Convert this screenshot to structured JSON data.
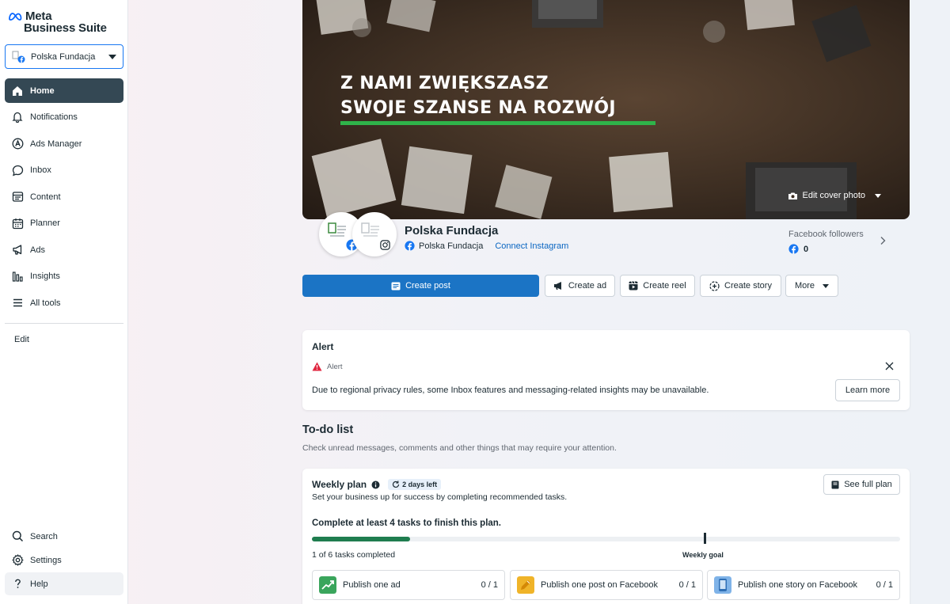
{
  "sidebar": {
    "logo_meta": "Meta",
    "logo_business_suite": "Business Suite",
    "account": "Polska Fundacja",
    "nav": [
      {
        "label": "Home",
        "icon": "home-icon",
        "active": true
      },
      {
        "label": "Notifications",
        "icon": "bell-icon"
      },
      {
        "label": "Ads Manager",
        "icon": "ads-manager-icon"
      },
      {
        "label": "Inbox",
        "icon": "inbox-icon"
      },
      {
        "label": "Content",
        "icon": "content-icon"
      },
      {
        "label": "Planner",
        "icon": "calendar-icon"
      },
      {
        "label": "Ads",
        "icon": "megaphone-icon"
      },
      {
        "label": "Insights",
        "icon": "bar-chart-icon"
      },
      {
        "label": "All tools",
        "icon": "menu-icon"
      }
    ],
    "edit": "Edit",
    "bottom": [
      {
        "label": "Search",
        "icon": "search-icon"
      },
      {
        "label": "Settings",
        "icon": "gear-icon"
      },
      {
        "label": "Help",
        "icon": "help-icon"
      }
    ]
  },
  "cover": {
    "headline_line1": "Z NAMI ZWIĘKSZASZ",
    "headline_line2": "SWOJE SZANSE NA ROZWÓJ",
    "edit_cover": "Edit cover photo"
  },
  "profile": {
    "name": "Polska Fundacja",
    "fb_page": "Polska Fundacja",
    "connect_instagram": "Connect Instagram",
    "followers_label": "Facebook followers",
    "followers_count": "0"
  },
  "actions": {
    "create_post": "Create post",
    "create_ad": "Create ad",
    "create_reel": "Create reel",
    "create_story": "Create story",
    "more": "More"
  },
  "alert": {
    "title": "Alert",
    "tag": "Alert",
    "message": "Due to regional privacy rules, some Inbox features and messaging-related insights may be unavailable.",
    "learn_more": "Learn more"
  },
  "todo": {
    "title": "To-do list",
    "subtitle": "Check unread messages, comments and other things that may require your attention."
  },
  "weekly_plan": {
    "title": "Weekly plan",
    "days_left": "2 days left",
    "description": "Set your business up for success by completing recommended tasks.",
    "see_full_plan": "See full plan",
    "goal_heading": "Complete at least 4 tasks to finish this plan.",
    "progress_fraction": 0.1667,
    "weekly_goal_fraction": 0.6667,
    "tasks_completed": "1 of 6 tasks completed",
    "weekly_goal_label": "Weekly goal",
    "tasks": [
      {
        "name": "Publish one ad",
        "count": "0 / 1",
        "color": "#3aa55c"
      },
      {
        "name": "Publish one post on Facebook",
        "count": "0 / 1",
        "color": "#f0b429"
      },
      {
        "name": "Publish one story on Facebook",
        "count": "0 / 1",
        "color": "#4a90d9"
      }
    ]
  },
  "colors": {
    "accent": "#1b74c5",
    "progress": "#1f7d4f",
    "cover_line": "#2fb34a",
    "facebook": "#1877f2"
  }
}
